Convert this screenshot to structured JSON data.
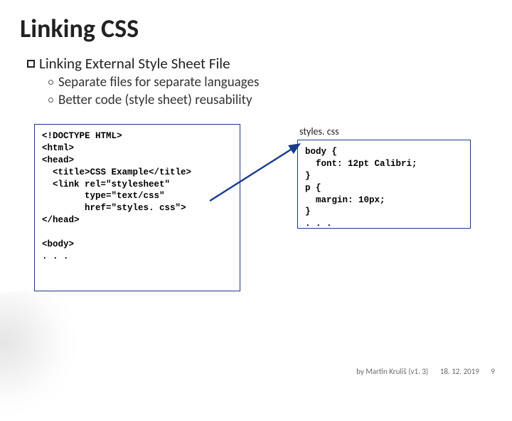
{
  "title": "Linking CSS",
  "bullet1": {
    "word1": "Linking",
    "rest": "External Style Sheet File"
  },
  "sub1": "Separate files for separate languages",
  "sub2": "Better code (style sheet) reusability",
  "filename_label": "styles. css",
  "code_left": "<!DOCTYPE HTML>\n<html>\n<head>\n  <title>CSS Example</title>\n  <link rel=\"stylesheet\"\n        type=\"text/css\"\n        href=\"styles. css\">\n</head>\n\n<body>\n. . .",
  "code_right": "body {\n  font: 12pt Calibri;\n}\np {\n  margin: 10px;\n}\n. . .",
  "footer_author": "by Martin Kruliš (v1. 3)",
  "footer_date": "18. 12. 2019",
  "page_number": "9"
}
